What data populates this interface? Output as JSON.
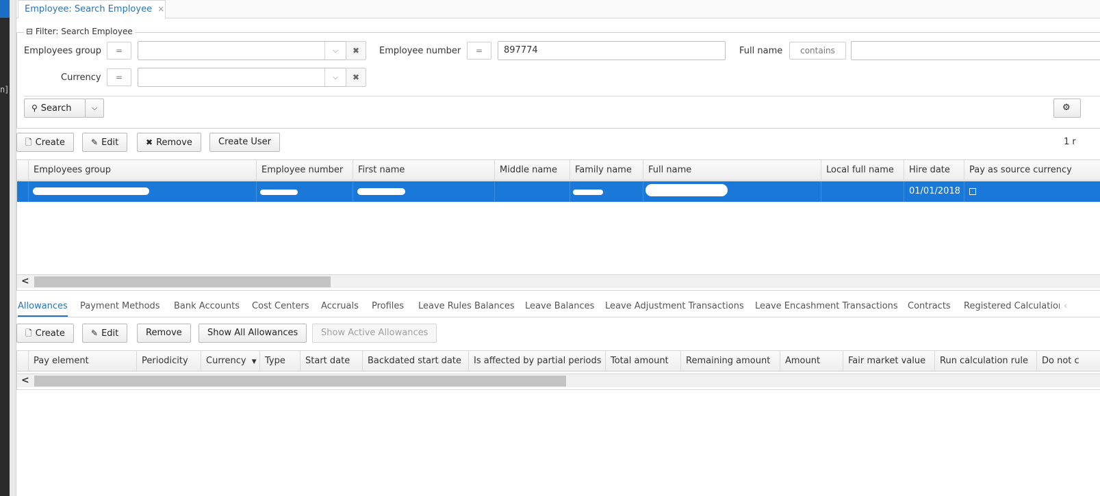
{
  "left_strip": {
    "text": "n]"
  },
  "tab": {
    "title": "Employee: Search Employee",
    "close": "×"
  },
  "filter": {
    "legend": "⊟ Filter: Search Employee",
    "employees_group": {
      "label": "Employees group",
      "op": "=",
      "value": ""
    },
    "employee_number": {
      "label": "Employee number",
      "op": "=",
      "value": "897774"
    },
    "full_name": {
      "label": "Full name",
      "op": "contains",
      "value": ""
    },
    "currency": {
      "label": "Currency",
      "op": "=",
      "value": ""
    },
    "search_label": "Search"
  },
  "toolbar": {
    "create": "Create",
    "edit": "Edit",
    "remove": "Remove",
    "create_user": "Create User",
    "count": "1 r"
  },
  "grid": {
    "columns": [
      "Employees group",
      "Employee number",
      "First name",
      "Middle name",
      "Family name",
      "Full name",
      "Local full name",
      "Hire date",
      "Pay as source currency"
    ],
    "row": {
      "hire_date": "01/01/2018"
    }
  },
  "detail_tabs": [
    "Allowances",
    "Payment Methods",
    "Bank Accounts",
    "Cost Centers",
    "Accruals",
    "Profiles",
    "Leave Rules Balances",
    "Leave Balances",
    "Leave Adjustment Transactions",
    "Leave Encashment Transactions",
    "Contracts",
    "Registered Calculation"
  ],
  "detail_tab_scroll": "‹",
  "detail_toolbar": {
    "create": "Create",
    "edit": "Edit",
    "remove": "Remove",
    "show_all": "Show All Allowances",
    "show_active": "Show Active Allowances"
  },
  "detail_grid": {
    "columns": [
      "Pay element",
      "Periodicity",
      "Currency",
      "Type",
      "Start date",
      "Backdated start date",
      "Is affected by partial periods",
      "Total amount",
      "Remaining amount",
      "Amount",
      "Fair market value",
      "Run calculation rule",
      "Do not c"
    ]
  },
  "colors": {
    "accent": "#2a72b5",
    "selection": "#1a79d8"
  }
}
